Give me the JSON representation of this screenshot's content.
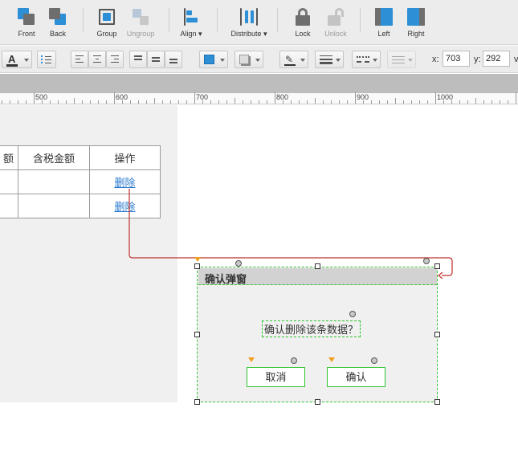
{
  "toolbar": {
    "buttons": [
      {
        "label": "Front",
        "icon": "bring-front-icon",
        "enabled": true
      },
      {
        "label": "Back",
        "icon": "send-back-icon",
        "enabled": true
      },
      {
        "label": "Group",
        "icon": "group-icon",
        "enabled": true
      },
      {
        "label": "Ungroup",
        "icon": "ungroup-icon",
        "enabled": false
      },
      {
        "label": "Align ▾",
        "icon": "align-icon",
        "enabled": true
      },
      {
        "label": "Distribute ▾",
        "icon": "distribute-icon",
        "enabled": true
      },
      {
        "label": "Lock",
        "icon": "lock-icon",
        "enabled": true
      },
      {
        "label": "Unlock",
        "icon": "unlock-icon",
        "enabled": false
      },
      {
        "label": "Left",
        "icon": "left-icon",
        "enabled": true
      },
      {
        "label": "Right",
        "icon": "right-icon",
        "enabled": true
      }
    ]
  },
  "format_bar": {
    "x_label": "x:",
    "x_value": "703",
    "y_label": "y:",
    "y_value": "292",
    "w_label_partial": "v",
    "fill_color": "#2d8fd5",
    "text_color": "#333333"
  },
  "ruler": {
    "labels": [
      "500",
      "600",
      "700",
      "800",
      "900",
      "1000"
    ]
  },
  "table": {
    "headers": [
      "额",
      "含税金额",
      "操作"
    ],
    "rows": [
      [
        "",
        "",
        "删除"
      ],
      [
        "",
        "",
        "删除"
      ]
    ]
  },
  "dialog": {
    "title": "确认弹窗",
    "message": "确认删除该条数据？",
    "cancel_label": "取消",
    "confirm_label": "确认",
    "border_color": "#2ec52e"
  },
  "connector": {
    "color": "#c0302a"
  }
}
